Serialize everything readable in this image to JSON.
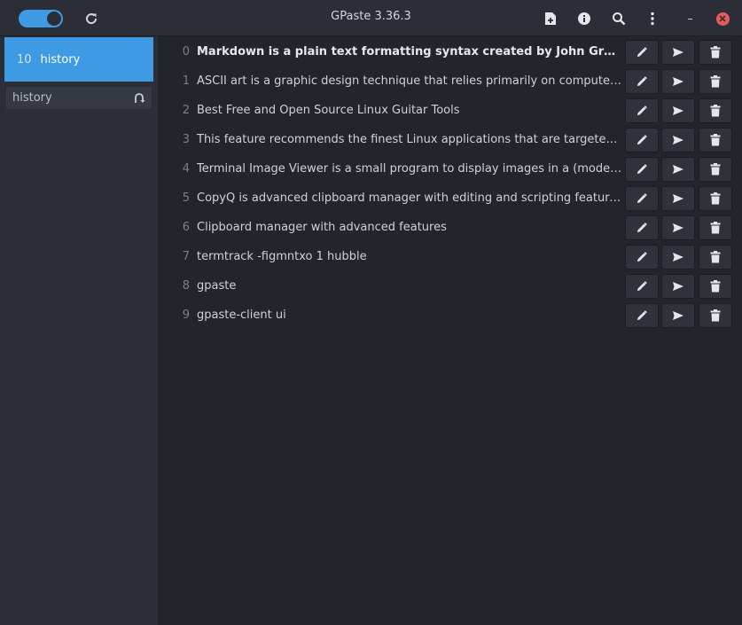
{
  "window": {
    "title": "GPaste 3.36.3"
  },
  "header": {
    "icons": {
      "refresh": "refresh-icon",
      "new_item": "new-document-icon",
      "about": "info-icon",
      "search": "search-icon",
      "menu": "kebab-menu-icon",
      "minimize": "minimize-icon",
      "close": "close-icon"
    },
    "toggle_on": true
  },
  "sidebar": {
    "active_history": {
      "count": "10",
      "name": "history"
    },
    "history_field": {
      "value": "history"
    }
  },
  "items": [
    {
      "index": "0",
      "text": "Markdown is a plain text formatting syntax created by John Gruber in ...",
      "bold": true
    },
    {
      "index": "1",
      "text": "ASCII art is a graphic design technique that relies primarily on computers for...",
      "bold": false
    },
    {
      "index": "2",
      "text": "Best Free and Open Source Linux Guitar Tools",
      "bold": false
    },
    {
      "index": "3",
      "text": "This feature recommends the finest Linux applications that are targeted at g...",
      "bold": false
    },
    {
      "index": "4",
      "text": "Terminal Image Viewer is a small program to display images in a (modern) ter...",
      "bold": false
    },
    {
      "index": "5",
      "text": "CopyQ is advanced clipboard manager with editing and scripting features.",
      "bold": false
    },
    {
      "index": "6",
      "text": "Clipboard manager with advanced features",
      "bold": false
    },
    {
      "index": "7",
      "text": "termtrack -figmntxo 1 hubble",
      "bold": false
    },
    {
      "index": "8",
      "text": "gpaste",
      "bold": false
    },
    {
      "index": "9",
      "text": "gpaste-client ui",
      "bold": false
    }
  ],
  "colors": {
    "accent": "#3d9ae3",
    "close": "#e95a5a"
  }
}
